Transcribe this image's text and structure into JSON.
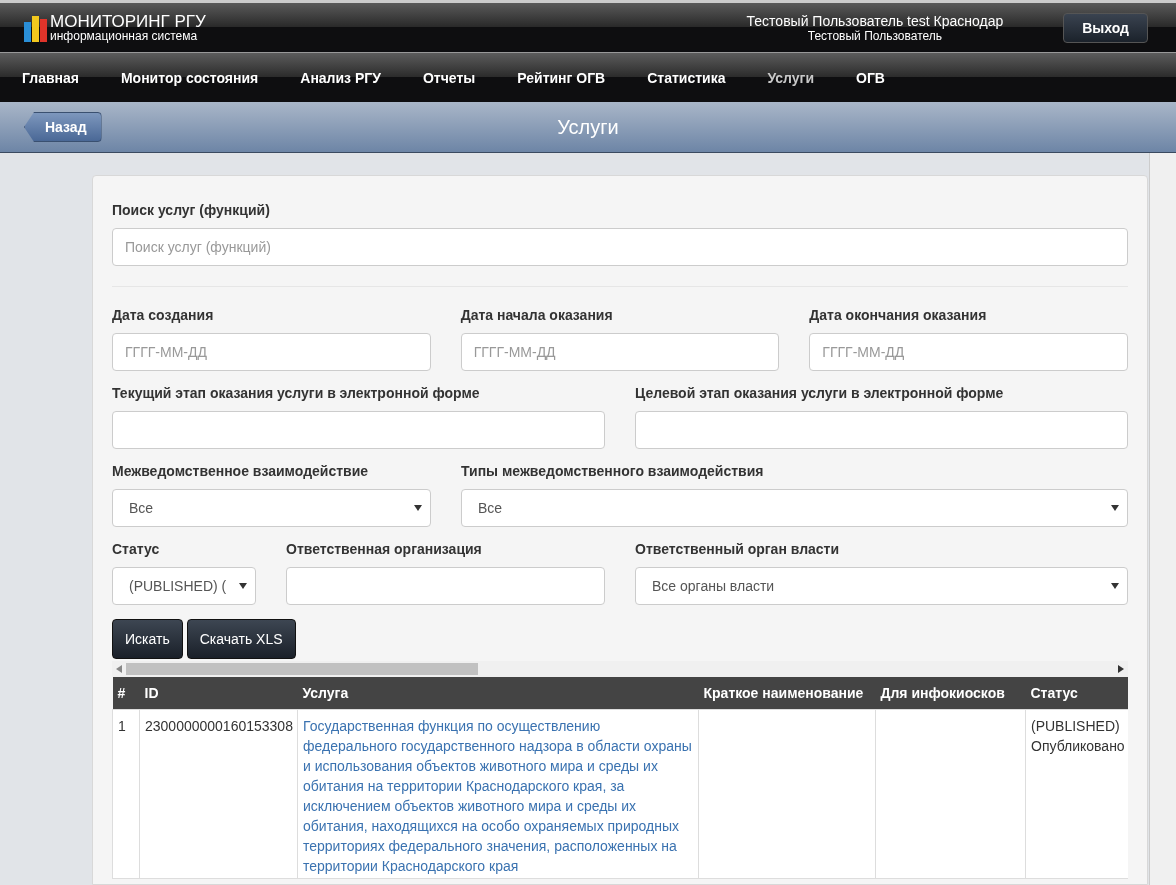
{
  "header": {
    "logo_title": "МОНИТОРИНГ РГУ",
    "logo_subtitle": "информационная система",
    "user_name": "Тестовый Пользователь test Краснодар",
    "user_role": "Тестовый Пользователь",
    "logout_button": "Выход"
  },
  "nav": [
    {
      "label": "Главная",
      "selected": false
    },
    {
      "label": "Монитор состояния",
      "selected": false
    },
    {
      "label": "Анализ РГУ",
      "selected": false
    },
    {
      "label": "Отчеты",
      "selected": false
    },
    {
      "label": "Рейтинг ОГВ",
      "selected": false
    },
    {
      "label": "Статистика",
      "selected": false
    },
    {
      "label": "Услуги",
      "selected": true
    },
    {
      "label": "ОГВ",
      "selected": false
    }
  ],
  "page": {
    "back_button": "Назад",
    "title": "Услуги"
  },
  "search": {
    "label": "Поиск услуг (функций)",
    "placeholder": "Поиск услуг (функций)"
  },
  "filter_rows": [
    [
      {
        "label": "Дата создания",
        "kind": "input",
        "placeholder": "ГГГГ-ММ-ДД"
      },
      {
        "label": "Дата начала оказания",
        "kind": "input",
        "placeholder": "ГГГГ-ММ-ДД"
      },
      {
        "label": "Дата окончания оказания",
        "kind": "input",
        "placeholder": "ГГГГ-ММ-ДД"
      }
    ],
    [
      {
        "label": "Текущий этап оказания услуги в электронной форме",
        "kind": "input"
      },
      {
        "label": "Целевой этап оказания услуги в электронной форме",
        "kind": "input"
      }
    ],
    [
      {
        "label": "Межведомственное взаимодействие",
        "kind": "select",
        "value": "Все"
      },
      {
        "label": "Типы межведомственного взаимодействия",
        "kind": "select",
        "value": "Все"
      }
    ],
    [
      {
        "label": "Статус",
        "kind": "select",
        "value": "(PUBLISHED) ("
      },
      {
        "label": "Ответственная организация",
        "kind": "input"
      },
      {
        "label": "Ответственный орган власти",
        "kind": "select",
        "value": "Все органы власти"
      }
    ]
  ],
  "buttons": [
    "Искать",
    "Скачать XLS"
  ],
  "table": {
    "columns": [
      "#",
      "ID",
      "Услуга",
      "Краткое наименование",
      "Для инфокиосков",
      "Статус"
    ],
    "rows": [
      {
        "cells": [
          "1",
          "2300000000160153308",
          "Государственная функция по осуществлению федерального государственного надзора в области охраны и использования объектов животного мира и среды их обитания на территории Краснодарского края, за исключением объектов животного мира и среды их обитания, находящихся на особо охраняемых природных территориях федерального значения, расположенных на территории Краснодарского края",
          "",
          "",
          "(PUBLISHED) Опубликовано"
        ]
      }
    ]
  }
}
